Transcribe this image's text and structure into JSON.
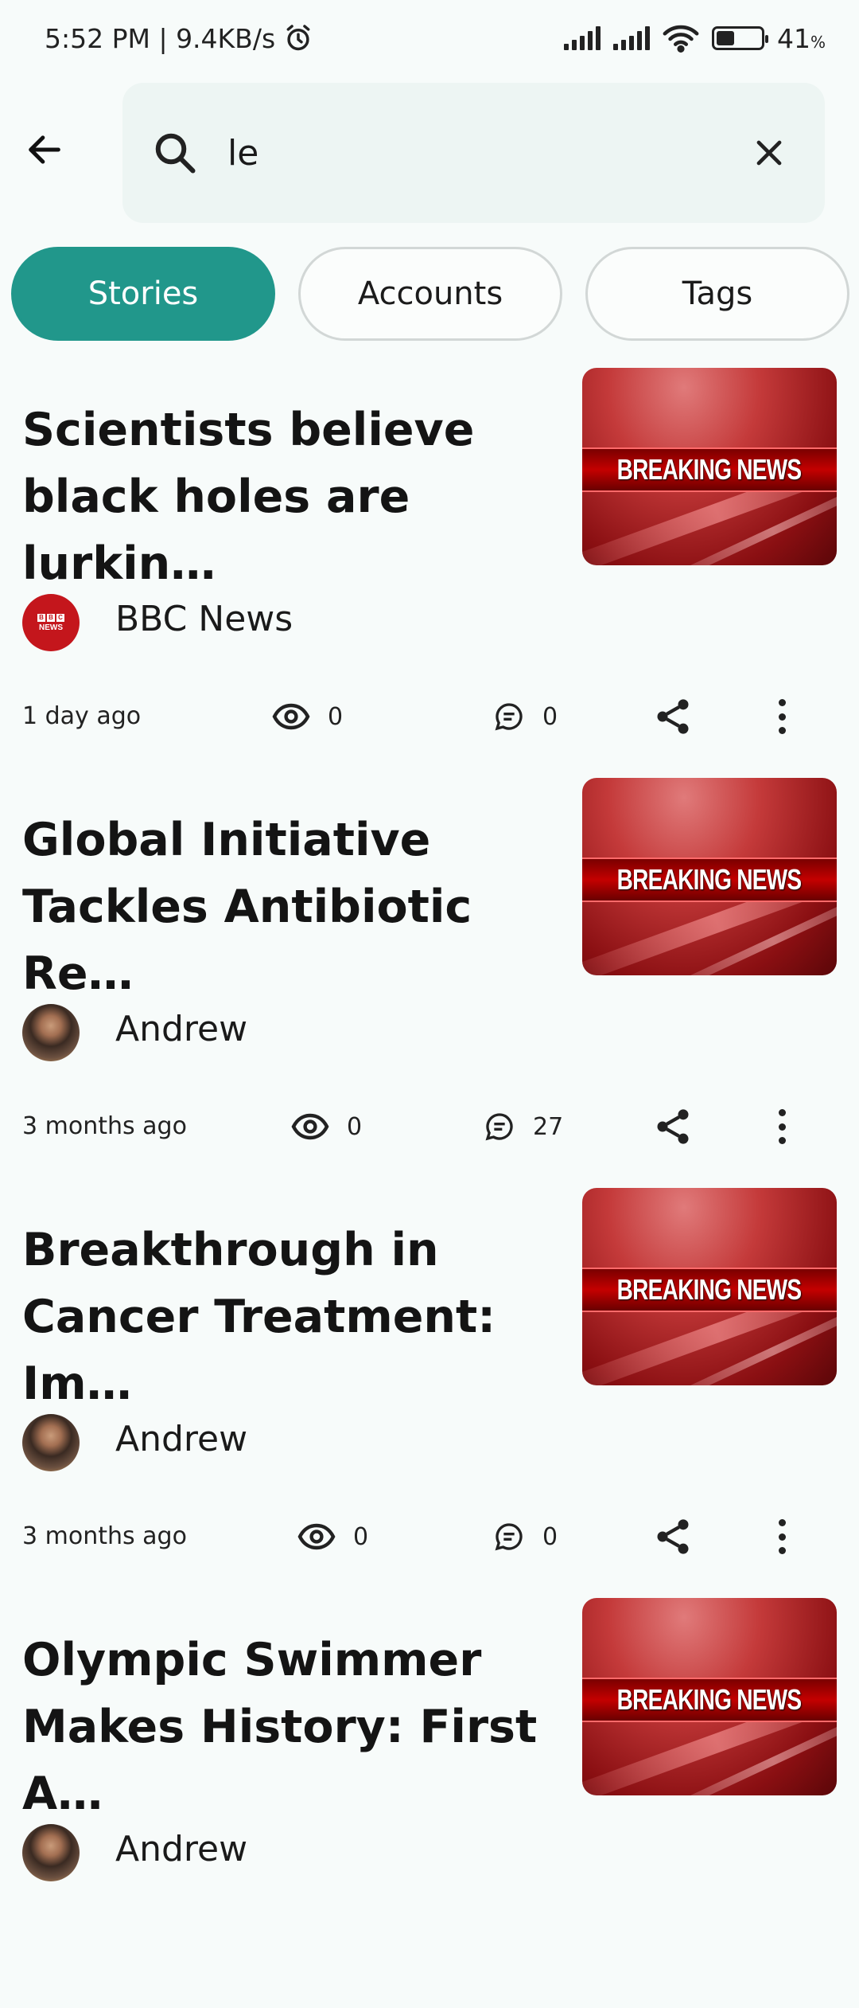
{
  "status_bar": {
    "time_speed": "5:52 PM | 9.4KB/s",
    "battery_percent": "41",
    "percent_sign": "%",
    "battery_level": 0.41
  },
  "search": {
    "query": "le",
    "placeholder": ""
  },
  "tabs": [
    {
      "label": "Stories",
      "active": true
    },
    {
      "label": "Accounts",
      "active": false
    },
    {
      "label": "Tags",
      "active": false
    }
  ],
  "thumbnail_text": "BREAKING NEWS",
  "stories": [
    {
      "title": "Scientists believe\nblack holes are lurkin…",
      "author": "BBC News",
      "avatar": "bbc-logo",
      "time": "1 day ago",
      "views": "0",
      "comments": "0"
    },
    {
      "title": "Global Initiative\nTackles Antibiotic Re…",
      "author": "Andrew",
      "avatar": "person-photo",
      "time": "3 months ago",
      "views": "0",
      "comments": "27"
    },
    {
      "title": "Breakthrough in\nCancer Treatment: Im…",
      "author": "Andrew",
      "avatar": "person-photo",
      "time": "3 months ago",
      "views": "0",
      "comments": "0"
    },
    {
      "title": "Olympic Swimmer\nMakes History: First A…",
      "author": "Andrew",
      "avatar": "person-photo",
      "time": "",
      "views": "",
      "comments": ""
    }
  ],
  "colors": {
    "accent": "#21978b",
    "background": "#f7fbfa",
    "search_bg": "#edf5f3"
  }
}
